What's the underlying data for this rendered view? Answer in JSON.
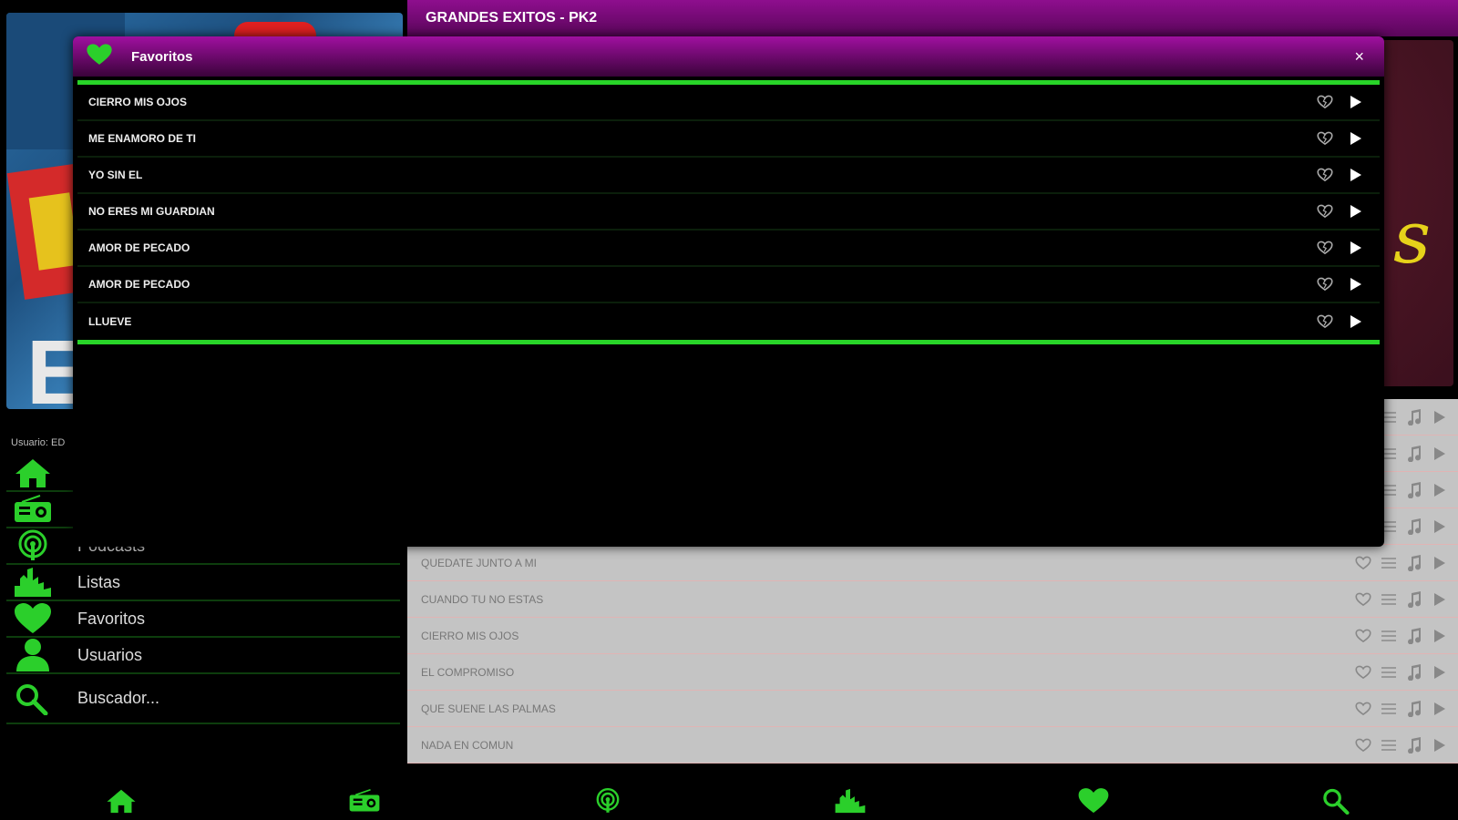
{
  "colors": {
    "accent_green": "#28d428",
    "header_purple": "#8e0e8e"
  },
  "sidebar": {
    "user_line": "Usuario: ED",
    "items": [
      {
        "label": "",
        "icon": "home-icon"
      },
      {
        "label": "",
        "icon": "radio-icon"
      },
      {
        "label": "Podcasts",
        "icon": "podcast-icon"
      },
      {
        "label": "Listas",
        "icon": "chart-icon"
      },
      {
        "label": "Favoritos",
        "icon": "heart-icon"
      },
      {
        "label": "Usuarios",
        "icon": "user-icon"
      }
    ],
    "search_label": "Buscador..."
  },
  "main": {
    "header_title": "GRANDES EXITOS - PK2",
    "songs": [
      {
        "title": ""
      },
      {
        "title": ""
      },
      {
        "title": ""
      },
      {
        "title": ""
      },
      {
        "title": "QUEDATE JUNTO A MI"
      },
      {
        "title": "CUANDO TU NO ESTAS"
      },
      {
        "title": "CIERRO MIS OJOS"
      },
      {
        "title": "EL COMPROMISO"
      },
      {
        "title": "QUE SUENE LAS PALMAS"
      },
      {
        "title": "NADA EN COMUN"
      }
    ]
  },
  "modal": {
    "title": "Favoritos",
    "close_label": "×",
    "favorites": [
      {
        "title": "CIERRO MIS OJOS"
      },
      {
        "title": "ME ENAMORO DE TI"
      },
      {
        "title": "YO SIN EL"
      },
      {
        "title": "NO ERES MI GUARDIAN"
      },
      {
        "title": "AMOR DE PECADO"
      },
      {
        "title": "AMOR DE PECADO"
      },
      {
        "title": "LLUEVE"
      }
    ]
  },
  "bottom_nav": [
    "home-icon",
    "radio-icon",
    "podcast-icon",
    "chart-icon",
    "heart-icon",
    "search-icon"
  ]
}
